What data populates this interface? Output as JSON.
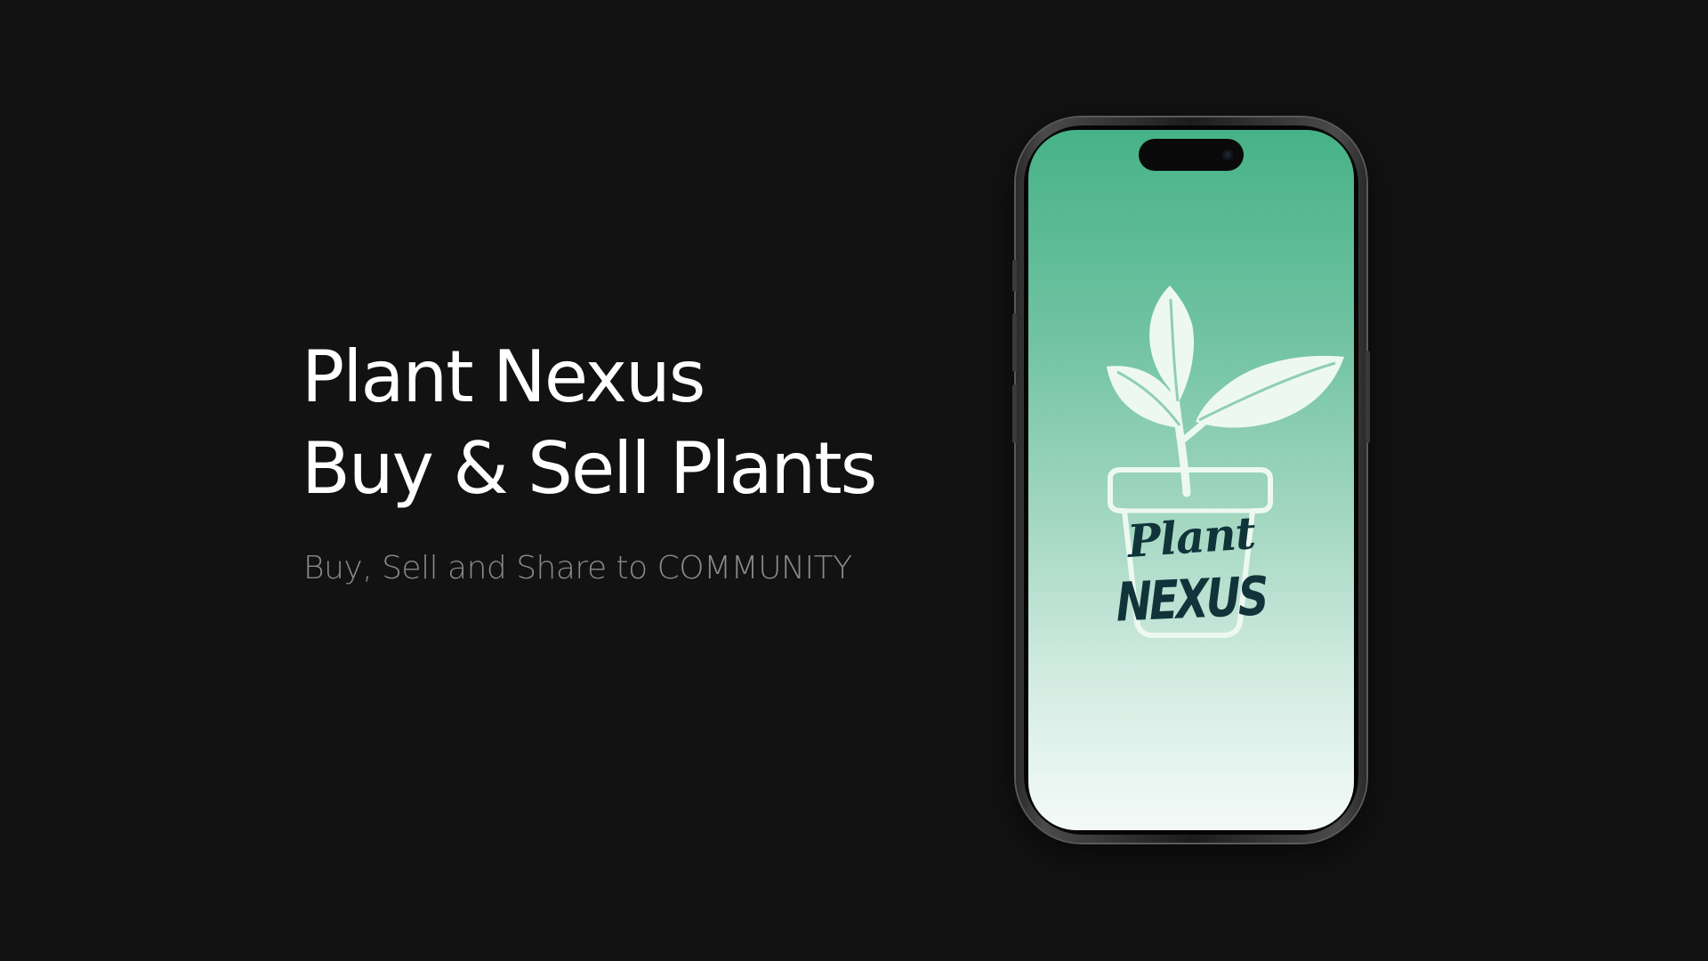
{
  "hero": {
    "title_line_1": "Plant Nexus",
    "title_line_2": "Buy & Sell Plants",
    "tagline": "Buy, Sell and Share to COMMUNITY"
  },
  "app_logo": {
    "word_1": "Plant",
    "word_2": "NEXUS",
    "icon": "plant-pot-icon"
  },
  "colors": {
    "background": "#121212",
    "screen_gradient_top": "#47b287",
    "screen_gradient_bottom": "#f3faf7",
    "logo_text": "#10343a",
    "tagline": "#8a8a8a"
  }
}
